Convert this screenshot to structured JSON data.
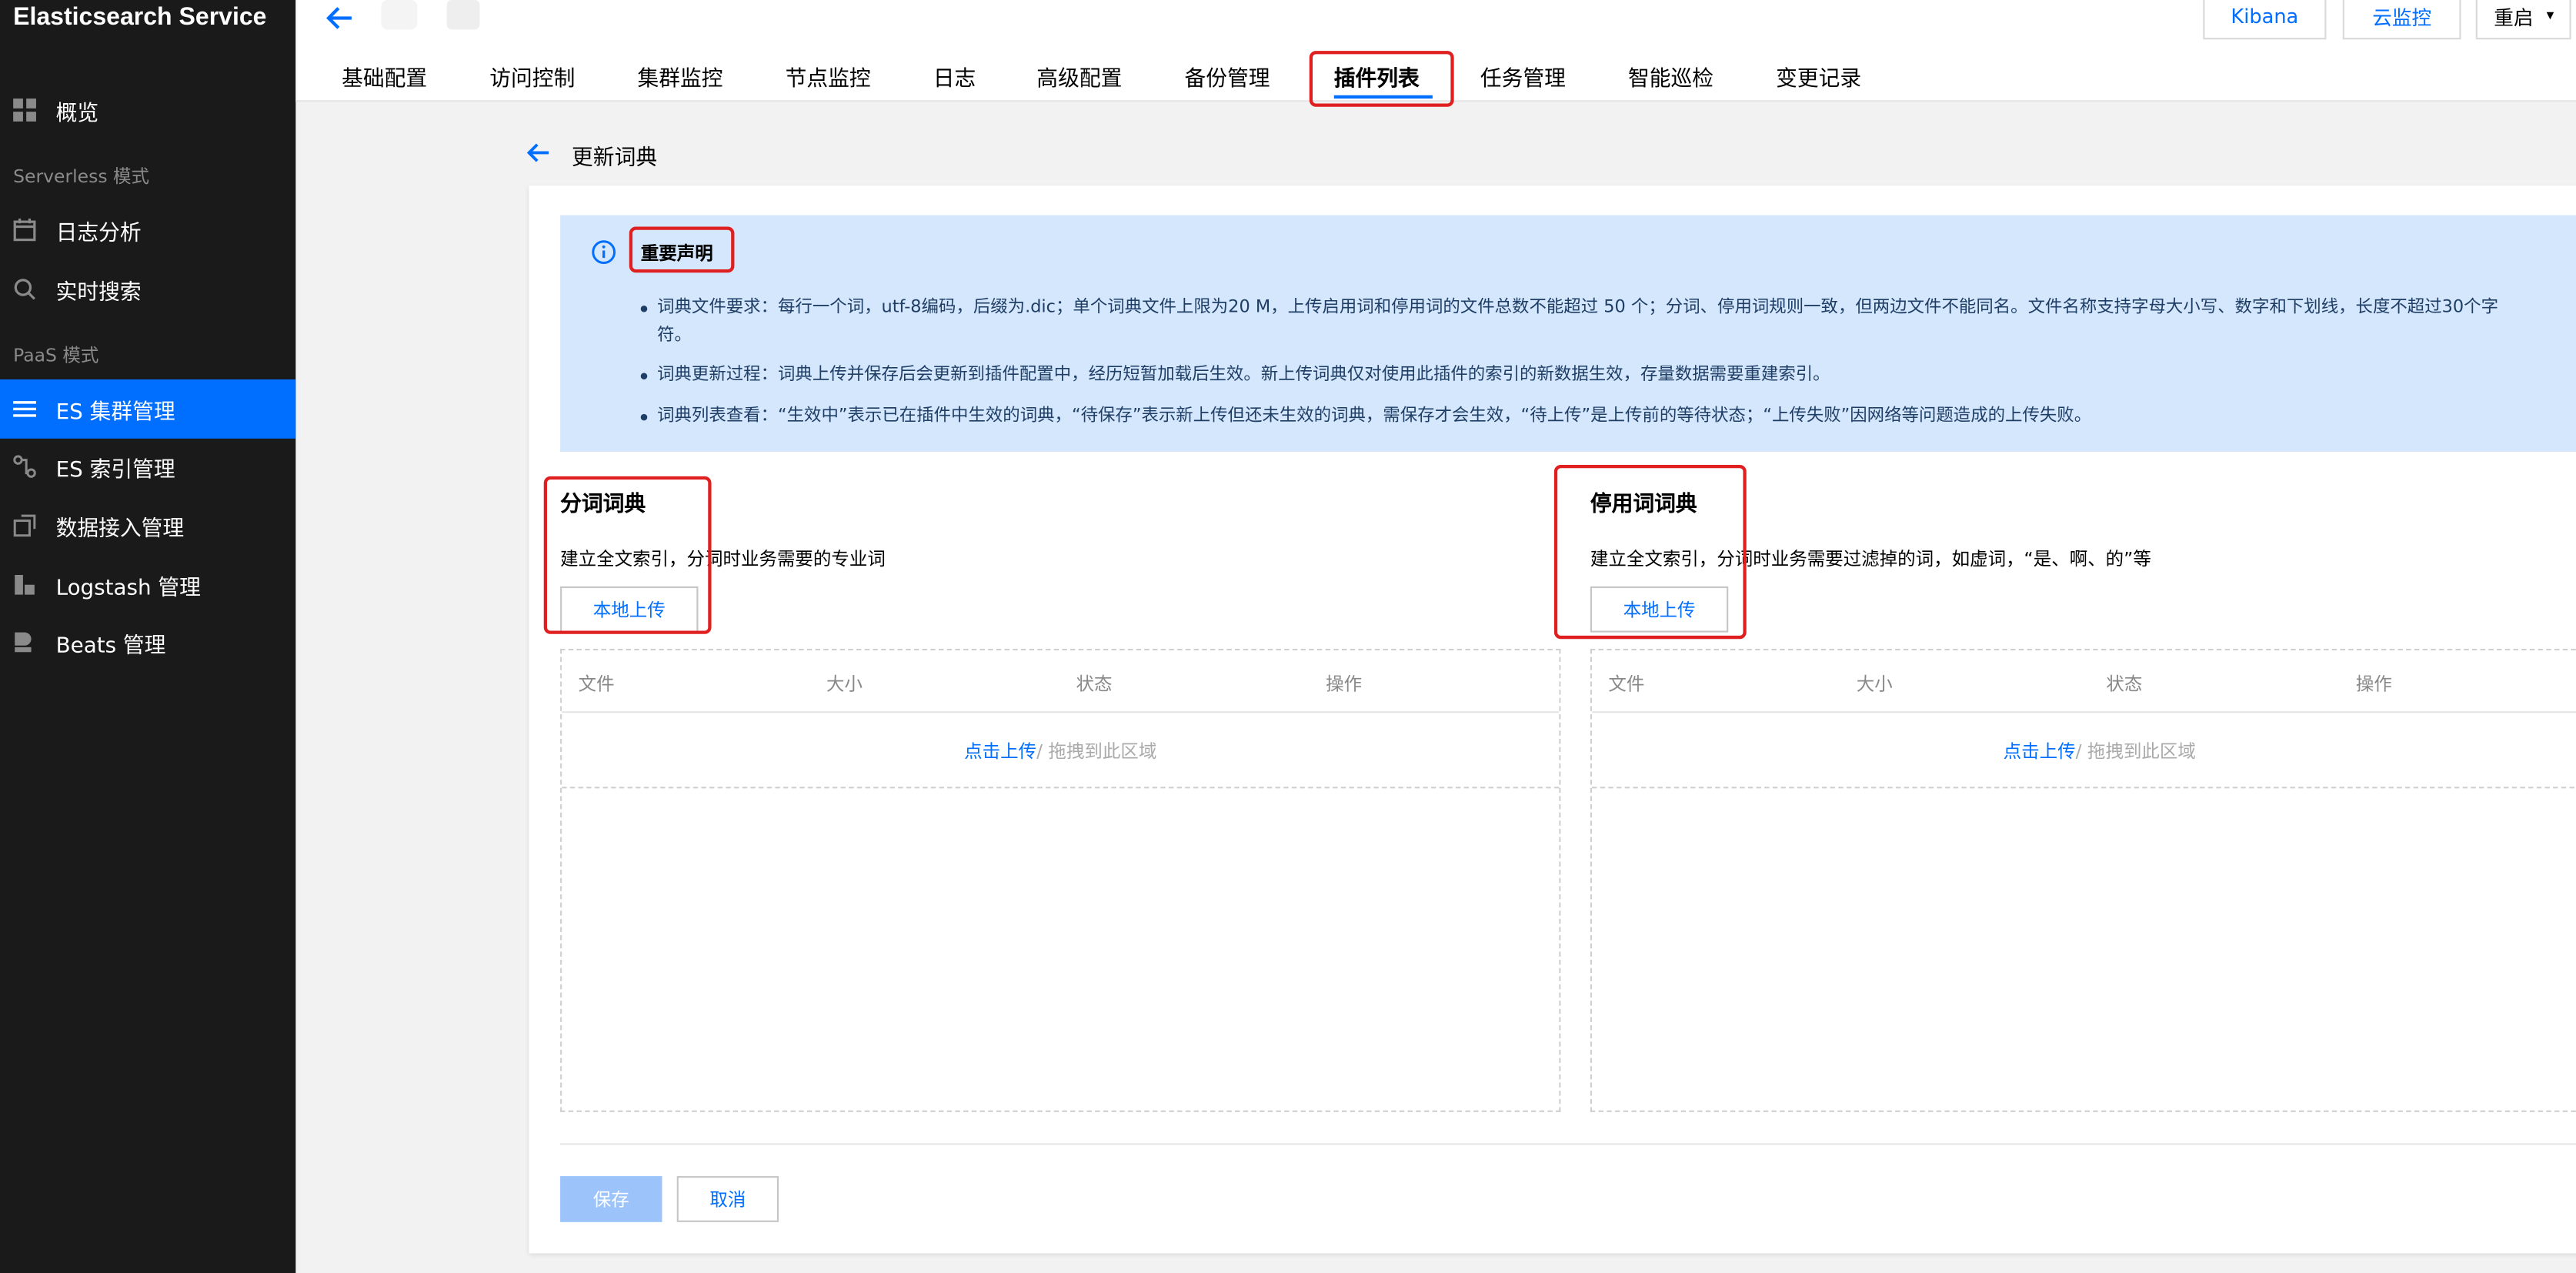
{
  "app": {
    "brand": "Elasticsearch Service"
  },
  "sidebar": {
    "items": [
      {
        "label": "概览",
        "icon": "grid-icon",
        "active": false
      },
      {
        "label": "日志分析",
        "icon": "calendar-icon",
        "active": false
      },
      {
        "label": "实时搜索",
        "icon": "search-icon",
        "active": false
      },
      {
        "label": "ES 集群管理",
        "icon": "list-icon",
        "active": true
      },
      {
        "label": "ES 索引管理",
        "icon": "nodes-icon",
        "active": false
      },
      {
        "label": "数据接入管理",
        "icon": "data-icon",
        "active": false
      },
      {
        "label": "Logstash 管理",
        "icon": "logstash-icon",
        "active": false
      },
      {
        "label": "Beats 管理",
        "icon": "beats-icon",
        "active": false
      }
    ],
    "sections": {
      "serverless": "Serverless 模式",
      "paas": "PaaS 模式"
    }
  },
  "topbar": {
    "buttons": {
      "kibana": "Kibana",
      "monitor": "云监控",
      "restart": "重启"
    },
    "tabs": [
      {
        "label": "基础配置"
      },
      {
        "label": "访问控制"
      },
      {
        "label": "集群监控"
      },
      {
        "label": "节点监控"
      },
      {
        "label": "日志"
      },
      {
        "label": "高级配置"
      },
      {
        "label": "备份管理"
      },
      {
        "label": "插件列表",
        "active": true
      },
      {
        "label": "任务管理"
      },
      {
        "label": "智能巡检"
      },
      {
        "label": "变更记录"
      }
    ]
  },
  "page": {
    "title": "更新词典"
  },
  "notice": {
    "title": "重要声明",
    "items": [
      "词典文件要求：每行一个词，utf-8编码，后缀为.dic；单个词典文件上限为20 M，上传启用词和停用词的文件总数不能超过 50 个；分词、停用词规则一致，但两边文件不能同名。文件名称支持字母大小写、数字和下划线，长度不超过30个字符。",
      "词典更新过程：词典上传并保存后会更新到插件配置中，经历短暂加载后生效。新上传词典仅对使用此插件的索引的新数据生效，存量数据需要重建索引。",
      "词典列表查看：“生效中”表示已在插件中生效的词典，“待保存”表示新上传但还未生效的词典，需保存才会生效，“待上传”是上传前的等待状态；“上传失败”因网络等问题造成的上传失败。"
    ]
  },
  "dict_segment": {
    "title": "分词词典",
    "desc": "建立全文索引，分词时业务需要的专业词",
    "upload": "本地上传",
    "columns": [
      "文件",
      "大小",
      "状态",
      "操作"
    ],
    "drop_link": "点击上传",
    "drop_hint": " / 拖拽到此区域"
  },
  "dict_stop": {
    "title": "停用词词典",
    "desc": "建立全文索引，分词时业务需要过滤掉的词，如虚词，“是、啊、的”等",
    "upload": "本地上传",
    "columns": [
      "文件",
      "大小",
      "状态",
      "操作"
    ],
    "drop_link": "点击上传",
    "drop_hint": " / 拖拽到此区域"
  },
  "footer": {
    "save": "保存",
    "cancel": "取消"
  },
  "colors": {
    "accent": "#006eff",
    "sidebar_bg": "#1a1a1a",
    "highlight": "#e02020",
    "notice_bg": "#d5e7fd"
  }
}
